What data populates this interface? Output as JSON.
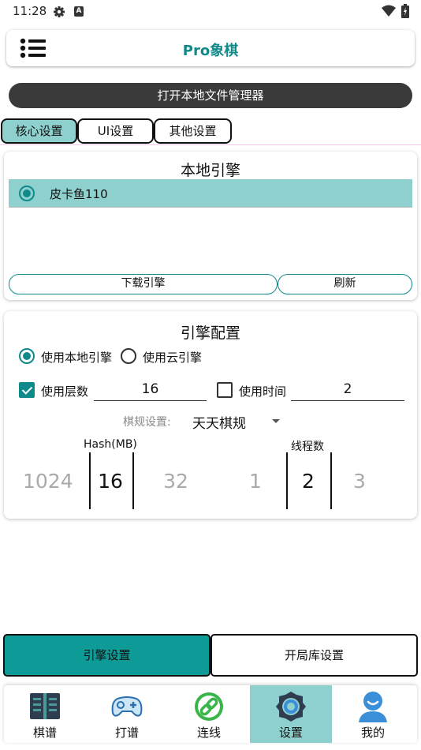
{
  "status_bar": {
    "time": "11:28",
    "a_badge": "A"
  },
  "app_bar": {
    "title": "Pro象棋"
  },
  "file_manager_button": "打开本地文件管理器",
  "tabs": [
    {
      "label": "核心设置",
      "active": true
    },
    {
      "label": "UI设置",
      "active": false
    },
    {
      "label": "其他设置",
      "active": false
    }
  ],
  "local_engines": {
    "title": "本地引擎",
    "items": [
      {
        "label": "皮卡鱼110",
        "selected": true
      }
    ],
    "download_label": "下载引擎",
    "refresh_label": "刷新"
  },
  "engine_config": {
    "title": "引擎配置",
    "use_local_label": "使用本地引擎",
    "use_local_selected": true,
    "use_cloud_label": "使用云引擎",
    "use_cloud_selected": false,
    "use_depth_label": "使用层数",
    "use_depth_checked": true,
    "depth_value": "16",
    "use_time_label": "使用时间",
    "use_time_checked": false,
    "time_value": "2",
    "rules_label": "棋规设置:",
    "rules_value": "天天棋规",
    "hash": {
      "title": "Hash(MB)",
      "prev": "1024",
      "selected": "16",
      "next": "32"
    },
    "threads": {
      "title": "线程数",
      "prev": "1",
      "selected": "2",
      "next": "3"
    }
  },
  "segments": {
    "engine_settings": "引擎设置",
    "opening_book_settings": "开局库设置"
  },
  "bottom_nav": [
    {
      "label": "棋谱",
      "icon": "book-icon",
      "active": false
    },
    {
      "label": "打谱",
      "icon": "gamepad-icon",
      "active": false
    },
    {
      "label": "连线",
      "icon": "link-icon",
      "active": false
    },
    {
      "label": "设置",
      "icon": "gear-icon",
      "active": true
    },
    {
      "label": "我的",
      "icon": "user-icon",
      "active": false
    }
  ],
  "colors": {
    "accent": "#0e8a8a",
    "selected_bg": "#8ed0cd",
    "segment_active": "#0e9a96"
  }
}
